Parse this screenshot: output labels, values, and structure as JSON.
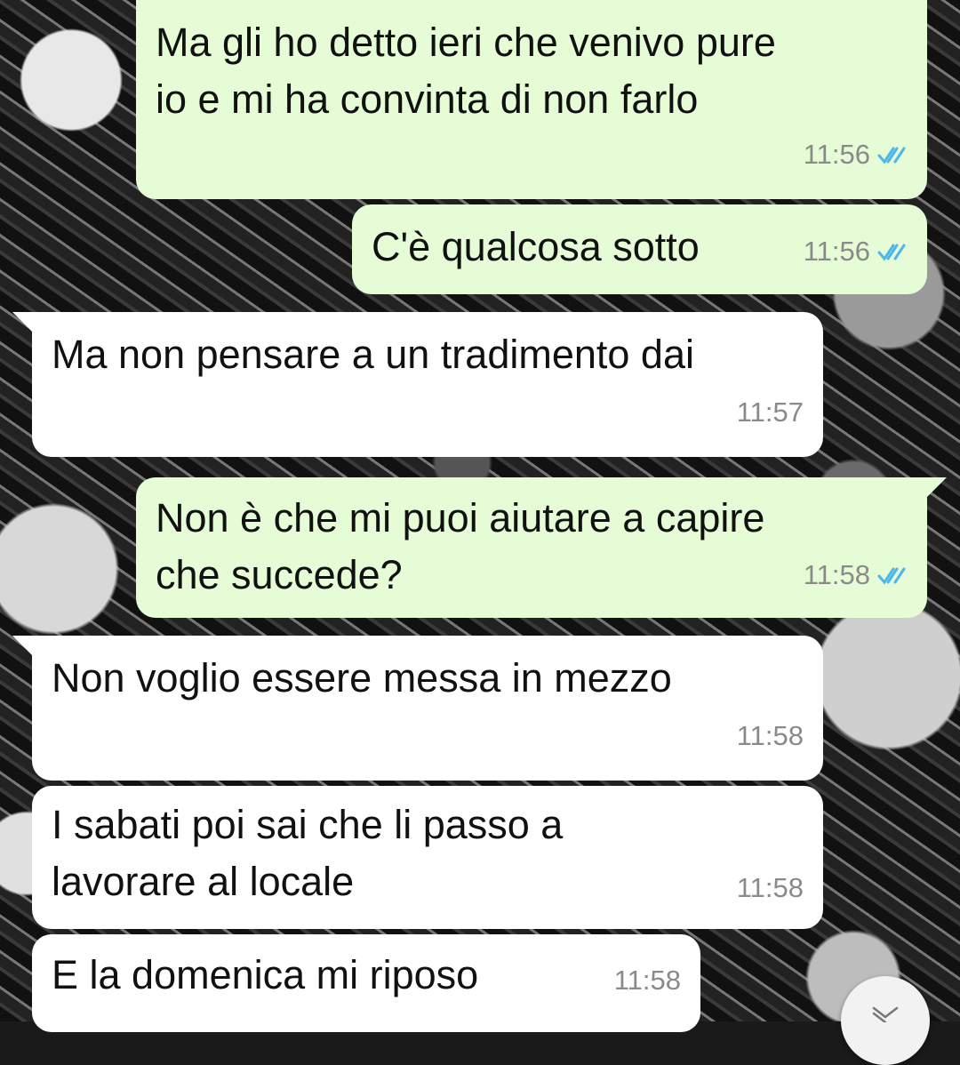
{
  "messages": [
    {
      "direction": "outgoing",
      "lines": [
        "Ma gli ho detto ieri che venivo pure",
        "io e mi ha convinta di non farlo"
      ],
      "time": "11:56",
      "status": "read"
    },
    {
      "direction": "outgoing",
      "lines": [
        "C'è qualcosa sotto"
      ],
      "time": "11:56",
      "status": "read"
    },
    {
      "direction": "incoming",
      "lines": [
        "Ma non pensare a un tradimento dai"
      ],
      "time": "11:57"
    },
    {
      "direction": "outgoing",
      "lines": [
        "Non è che mi puoi aiutare a capire",
        "che succede?"
      ],
      "time": "11:58",
      "status": "read"
    },
    {
      "direction": "incoming",
      "lines": [
        "Non voglio essere messa in mezzo"
      ],
      "time": "11:58"
    },
    {
      "direction": "incoming",
      "lines": [
        "I sabati poi sai che li passo a",
        "lavorare al locale"
      ],
      "time": "11:58"
    },
    {
      "direction": "incoming",
      "lines": [
        "E la domenica mi riposo"
      ],
      "time": "11:58"
    }
  ],
  "icons": {
    "read_receipt": "double-check-icon",
    "scroll_button": "chevron-down-icon"
  },
  "colors": {
    "outgoing_bubble": "#e6fcd6",
    "incoming_bubble": "#ffffff",
    "read_tick": "#4fb6ec",
    "timestamp": "#8a8a8a"
  }
}
